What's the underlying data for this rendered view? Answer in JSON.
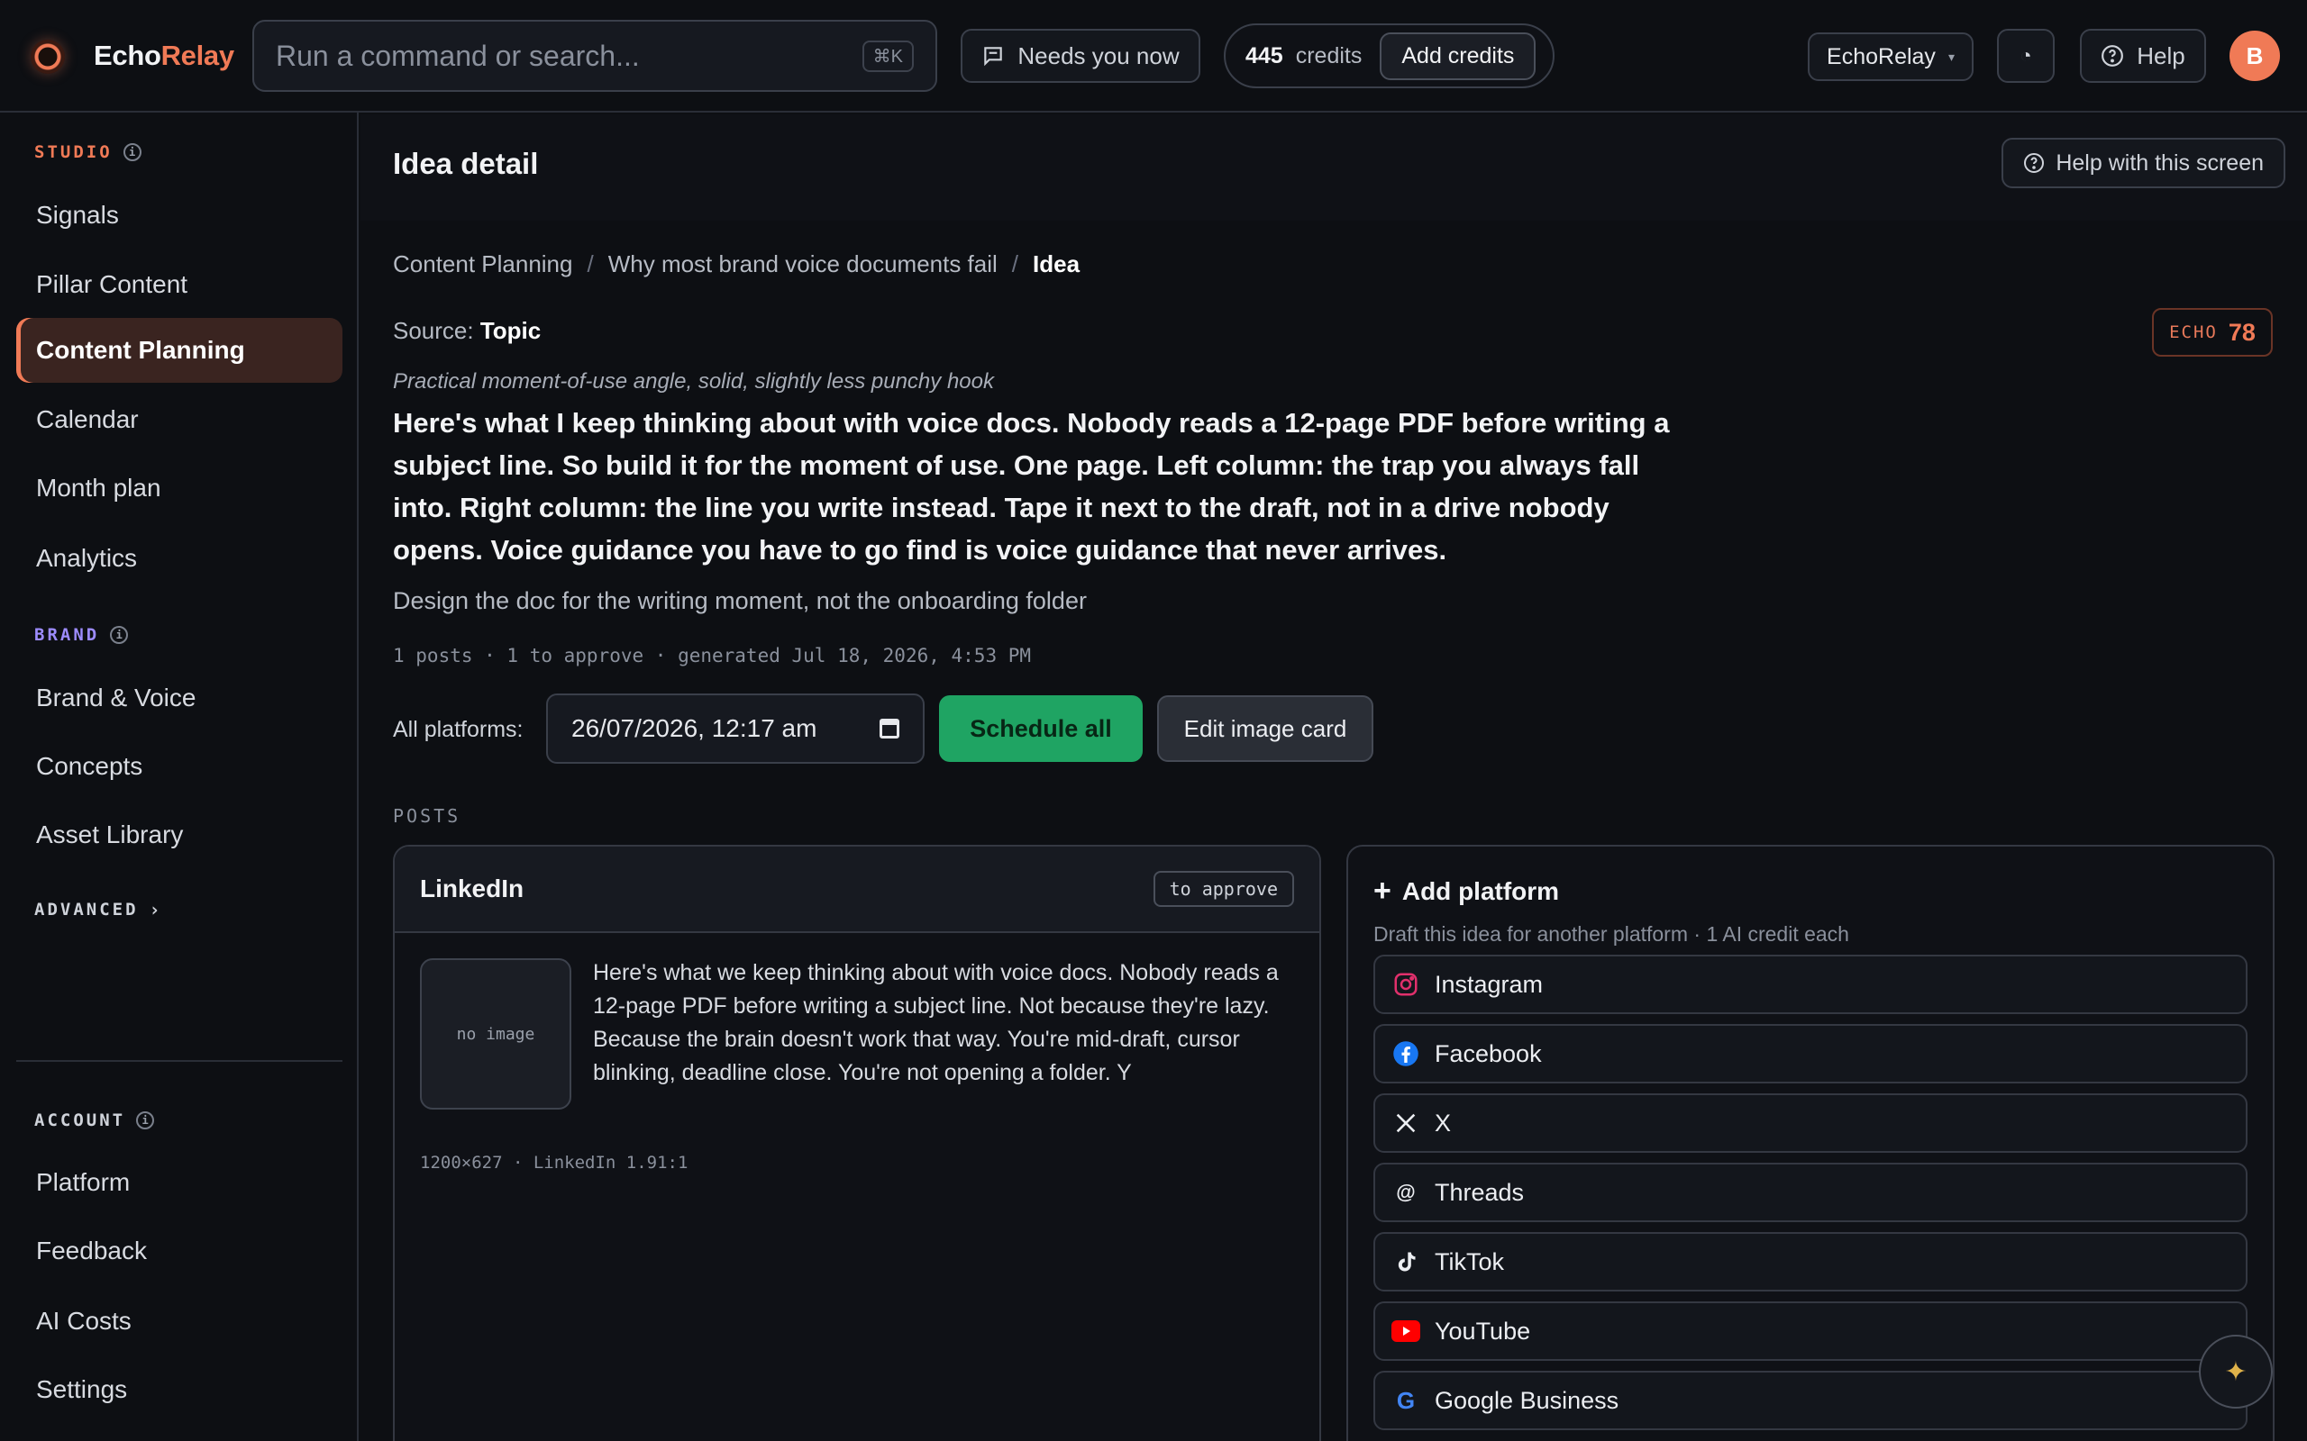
{
  "app": {
    "brand_part1": "Echo",
    "brand_part2": "Relay"
  },
  "topbar": {
    "search_placeholder": "Run a command or search...",
    "search_shortcut": "⌘K",
    "needs_label": "Needs you now",
    "credits_count": "445",
    "credits_label": "credits",
    "add_credits_label": "Add credits",
    "workspace": "EchoRelay",
    "theme_glyph": "◔",
    "help_label": "Help",
    "avatar_initial": "B"
  },
  "sidebar": {
    "studio_label": "STUDIO",
    "studio_items": [
      "Signals",
      "Pillar Content",
      "Content Planning",
      "Calendar",
      "Month plan",
      "Analytics"
    ],
    "brand_label": "BRAND",
    "brand_items": [
      "Brand & Voice",
      "Concepts",
      "Asset Library"
    ],
    "advanced_label": "ADVANCED",
    "account_label": "ACCOUNT",
    "account_items": [
      "Platform",
      "Feedback",
      "AI Costs",
      "Settings"
    ]
  },
  "main": {
    "title": "Idea detail",
    "help_screen_label": "Help with this screen",
    "breadcrumb": [
      "Content Planning",
      "Why most brand voice documents fail",
      "Idea"
    ],
    "source_label": "Source:",
    "source_value": "Topic",
    "echo_label": "ECHO",
    "echo_score": "78",
    "angle": "Practical moment-of-use angle, solid, slightly less punchy hook",
    "hook": "Here's what I keep thinking about with voice docs. Nobody reads a 12-page PDF before writing a subject line. So build it for the moment of use. One page. Left column: the trap you always fall into. Right column: the line you write instead. Tape it next to the draft, not in a drive nobody opens. Voice guidance you have to go find is voice guidance that never arrives.",
    "subline": "Design the doc for the writing moment, not the onboarding folder",
    "meta": "1 posts · 1 to approve · generated Jul 18, 2026, 4:53 PM",
    "all_platforms_label": "All platforms:",
    "schedule_datetime": "26/07/2026, 12:17 am",
    "schedule_all_label": "Schedule all",
    "edit_image_label": "Edit image card",
    "posts_label": "POSTS"
  },
  "post": {
    "platform": "LinkedIn",
    "status": "to approve",
    "image_placeholder": "no image",
    "text": "Here's what we keep thinking about with voice docs. Nobody reads a 12-page PDF before writing a subject line. Not because they're lazy. Because the brain doesn't work that way. You're mid-draft, cursor blinking, deadline close. You're not opening a folder. Y",
    "dimensions": "1200×627 · LinkedIn 1.91:1"
  },
  "add_platform": {
    "title": "Add platform",
    "subtitle": "Draft this idea for another platform · 1 AI credit each",
    "platforms": [
      "Instagram",
      "Facebook",
      "X",
      "Threads",
      "TikTok",
      "YouTube",
      "Google Business"
    ]
  },
  "colors": {
    "accent": "#f07a56",
    "success": "#1fa463",
    "brand_section": "#9d8cff"
  }
}
